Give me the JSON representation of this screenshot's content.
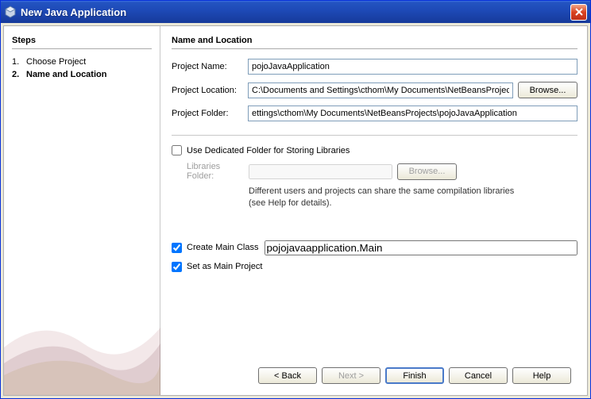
{
  "window": {
    "title": "New Java Application"
  },
  "sidebar": {
    "heading": "Steps",
    "items": [
      {
        "num": "1.",
        "label": "Choose Project",
        "active": false
      },
      {
        "num": "2.",
        "label": "Name and Location",
        "active": true
      }
    ]
  },
  "main": {
    "heading": "Name and Location",
    "projectName": {
      "label": "Project Name:",
      "value": "pojoJavaApplication"
    },
    "projectLocation": {
      "label": "Project Location:",
      "value": "C:\\Documents and Settings\\cthom\\My Documents\\NetBeansProjects",
      "browse": "Browse..."
    },
    "projectFolder": {
      "label": "Project Folder:",
      "value": "ettings\\cthom\\My Documents\\NetBeansProjects\\pojoJavaApplication"
    },
    "dedicated": {
      "label": "Use Dedicated Folder for Storing Libraries",
      "checked": false
    },
    "librariesFolder": {
      "label": "Libraries Folder:",
      "value": "",
      "browse": "Browse..."
    },
    "hint": "Different users and projects can share the same compilation libraries (see Help for details).",
    "createMain": {
      "label": "Create Main Class",
      "checked": true,
      "value": "pojojavaapplication.Main"
    },
    "setMain": {
      "label": "Set as Main Project",
      "checked": true
    }
  },
  "buttons": {
    "back": "< Back",
    "next": "Next >",
    "finish": "Finish",
    "cancel": "Cancel",
    "help": "Help"
  }
}
